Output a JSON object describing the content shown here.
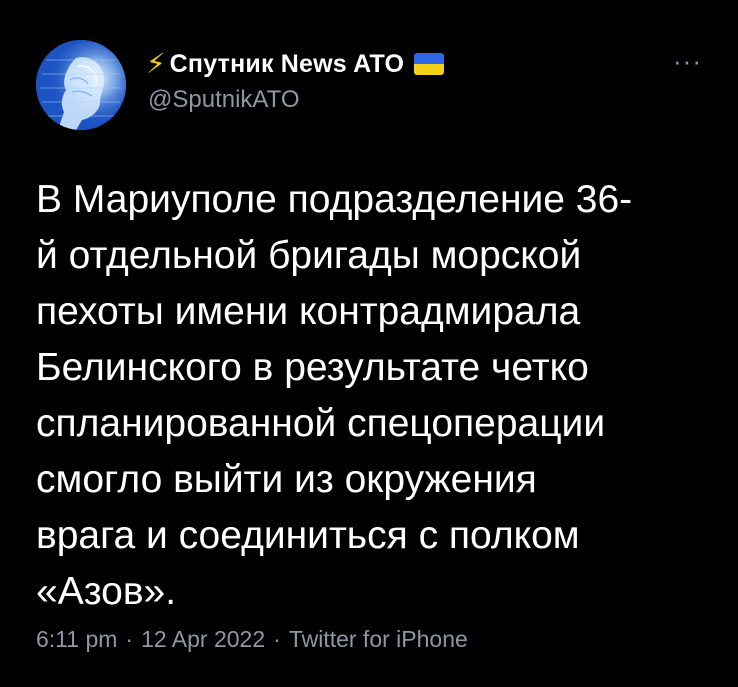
{
  "tweet": {
    "author": {
      "name": "Спутник News ATO",
      "handle": "@SputnikATO",
      "name_icon": "lightning-bolt-icon",
      "flag": "ukraine-flag-icon"
    },
    "more_icon": "more-options-icon",
    "text": "В Мариуполе подразделение 36-\nй отдельной бригады морской\nпехоты имени контрадмирала\nБелинского в результате четко\nспланированной спецоперации\nсмогло выйти из окружения\nврага и соединиться с полком\n«Азов».",
    "time": "6:11 pm",
    "date": "12 Apr 2022",
    "source": "Twitter for iPhone",
    "separator": "·"
  },
  "colors": {
    "background": "#000000",
    "text": "#ffffff",
    "secondary": "#8b98a5",
    "bolt": "#f3c623",
    "flag_blue": "#2f66e6",
    "flag_yellow": "#f6d11a"
  }
}
